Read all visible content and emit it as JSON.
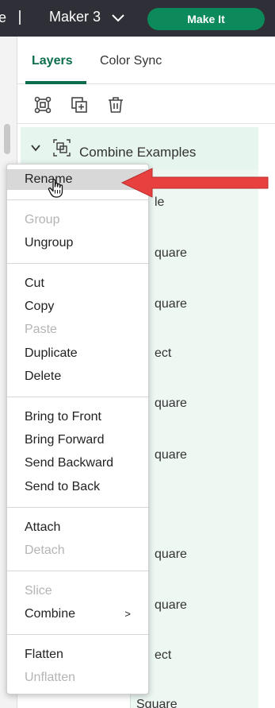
{
  "topbar": {
    "truncated_text": "e",
    "machine_name": "Maker 3",
    "make_it_label": "Make It"
  },
  "tabs": [
    {
      "label": "Layers"
    },
    {
      "label": "Color Sync"
    }
  ],
  "toolbar": {
    "icons": [
      "group-icon",
      "duplicate-icon",
      "delete-icon"
    ]
  },
  "layers": {
    "group_label": "Combine Examples",
    "children_visible_text": [
      "le",
      "quare",
      "quare",
      "ect",
      "quare",
      "quare",
      "quare",
      "quare",
      "ect",
      "Square"
    ]
  },
  "context_menu": {
    "items": [
      {
        "label": "Rename",
        "enabled": true,
        "hovered": true
      },
      {
        "label": "Group",
        "enabled": false
      },
      {
        "label": "Ungroup",
        "enabled": true
      },
      {
        "label": "Cut",
        "enabled": true
      },
      {
        "label": "Copy",
        "enabled": true
      },
      {
        "label": "Paste",
        "enabled": false
      },
      {
        "label": "Duplicate",
        "enabled": true
      },
      {
        "label": "Delete",
        "enabled": true
      },
      {
        "label": "Bring to Front",
        "enabled": true
      },
      {
        "label": "Bring Forward",
        "enabled": true
      },
      {
        "label": "Send Backward",
        "enabled": true
      },
      {
        "label": "Send to Back",
        "enabled": true
      },
      {
        "label": "Attach",
        "enabled": true
      },
      {
        "label": "Detach",
        "enabled": false
      },
      {
        "label": "Slice",
        "enabled": false
      },
      {
        "label": "Combine",
        "enabled": true,
        "submenu_indicator": ">"
      },
      {
        "label": "Flatten",
        "enabled": true
      },
      {
        "label": "Unflatten",
        "enabled": false
      }
    ]
  },
  "colors": {
    "accent_green": "#0c6e4c",
    "make_it_green": "#0d8a5c",
    "topbar_bg": "#2f3037",
    "annotation_arrow": "#e8403f"
  }
}
